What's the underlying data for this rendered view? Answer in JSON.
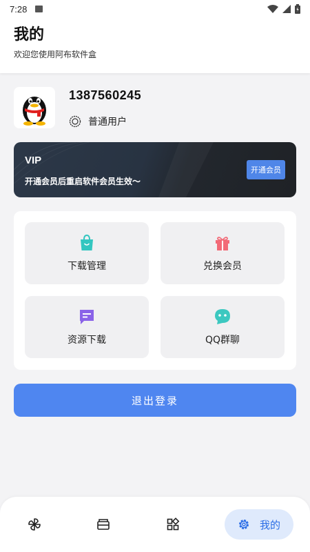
{
  "status_bar": {
    "time": "7:28"
  },
  "header": {
    "title": "我的",
    "subtitle": "欢迎您使用阿布软件盒"
  },
  "profile": {
    "phone": "1387560245",
    "role": "普通用户"
  },
  "vip": {
    "label": "VIP",
    "description": "开通会员后重启软件会员生效～",
    "button": "开通会员"
  },
  "grid": [
    {
      "label": "下载管理",
      "icon": "shopping-bag-icon",
      "color": "#33c6c0"
    },
    {
      "label": "兑换会员",
      "icon": "gift-icon",
      "color": "#f26a77"
    },
    {
      "label": "资源下载",
      "icon": "message-icon",
      "color": "#8a63e8"
    },
    {
      "label": "QQ群聊",
      "icon": "chat-face-icon",
      "color": "#3cc8c0"
    }
  ],
  "logout": {
    "label": "退出登录"
  },
  "bottom_nav": {
    "items": [
      {
        "icon": "pinwheel-icon"
      },
      {
        "icon": "ticket-icon"
      },
      {
        "icon": "apps-icon"
      },
      {
        "icon": "gear-icon",
        "label": "我的",
        "active": true
      }
    ]
  },
  "colors": {
    "accent": "#4f86f0",
    "nav_active_bg": "#dfeafc"
  }
}
